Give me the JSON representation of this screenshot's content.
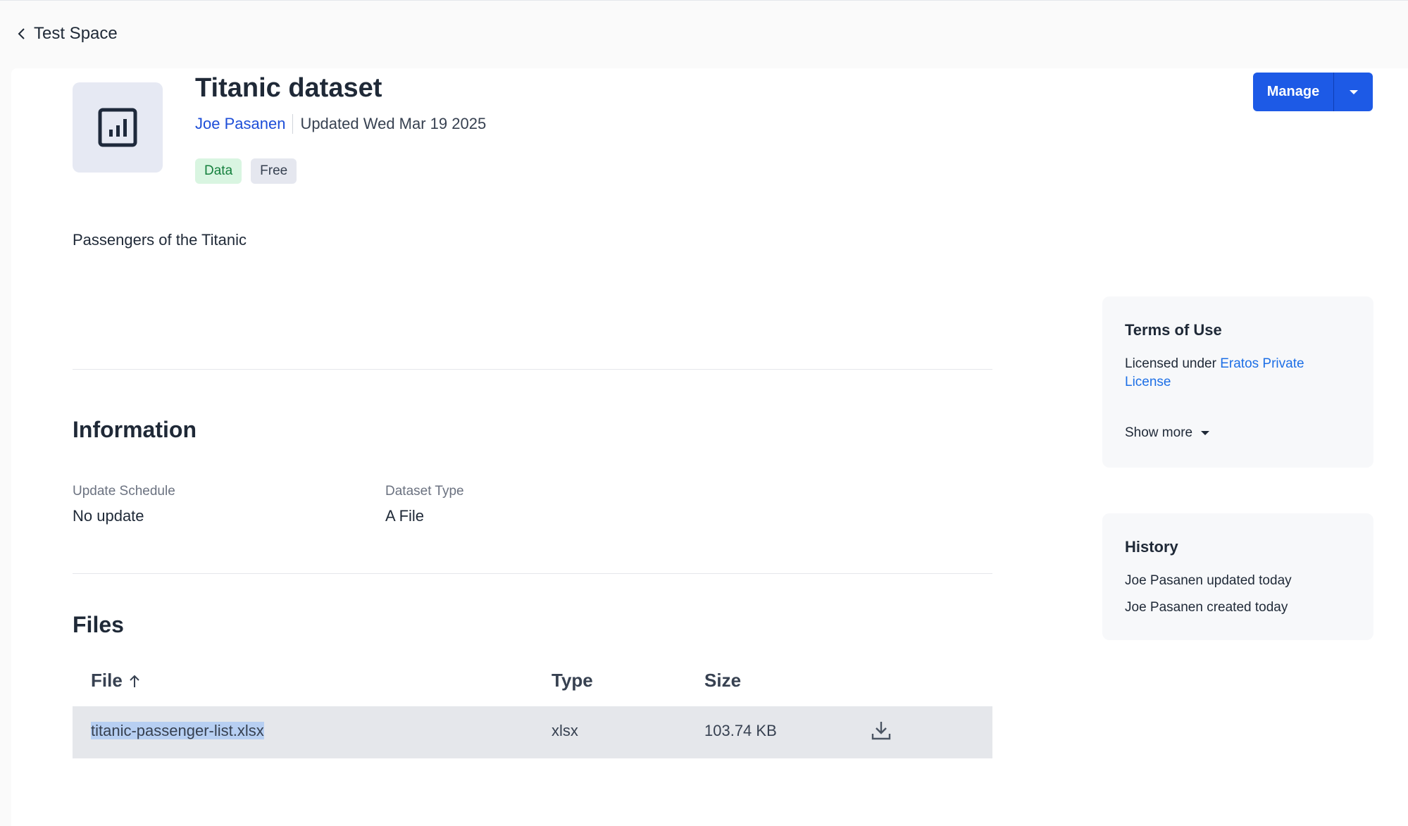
{
  "breadcrumb": {
    "back_label": "Test Space"
  },
  "dataset": {
    "title": "Titanic dataset",
    "author": "Joe Pasanen",
    "updated": "Updated Wed Mar 19 2025",
    "tags": [
      "Data",
      "Free"
    ],
    "description": "Passengers of the Titanic"
  },
  "actions": {
    "manage_label": "Manage"
  },
  "information": {
    "heading": "Information",
    "fields": [
      {
        "label": "Update Schedule",
        "value": "No update"
      },
      {
        "label": "Dataset Type",
        "value": "A File"
      }
    ]
  },
  "files": {
    "heading": "Files",
    "columns": [
      "File",
      "Type",
      "Size"
    ],
    "rows": [
      {
        "name": "titanic-passenger-list.xlsx",
        "type": "xlsx",
        "size": "103.74 KB"
      }
    ]
  },
  "terms": {
    "heading": "Terms of Use",
    "prefix": "Licensed under ",
    "license_link": "Eratos Private License",
    "show_more": "Show more"
  },
  "history": {
    "heading": "History",
    "entries": [
      "Joe Pasanen updated today",
      "Joe Pasanen created today"
    ]
  },
  "colors": {
    "primary": "#1d5ae6",
    "link": "#1d4ed8",
    "tag_data_bg": "#d9f5e1",
    "tag_free_bg": "#e5e7ef"
  },
  "icons": {
    "back": "chevron-left-icon",
    "dataset": "bar-chart-icon",
    "manage_menu": "caret-down-icon",
    "sort": "arrow-up-icon",
    "download": "download-icon"
  }
}
